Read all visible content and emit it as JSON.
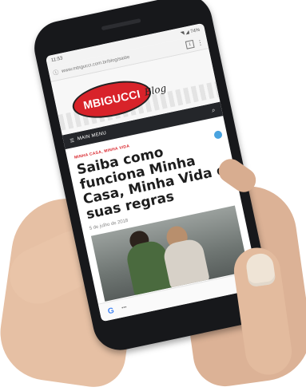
{
  "browser": {
    "time": "11:53",
    "url": "www.mbigucci.com.br/blog/saibe",
    "tab_count": "1",
    "status_icons": "◥ ◢ 74%"
  },
  "site": {
    "logo_text": "MBIGUCCI",
    "logo_suffix": "Blog",
    "menu_label": "MAIN MENU"
  },
  "article": {
    "kicker": "MINHA CASA, MINHA VIDA",
    "title": "Saiba como funciona Minha Casa, Minha Vida e suas regras",
    "date": "5 de julho de 2018"
  },
  "bottom": {
    "google": "G"
  },
  "colors": {
    "brand_red": "#d8232a",
    "menu_bg": "#24262a"
  }
}
